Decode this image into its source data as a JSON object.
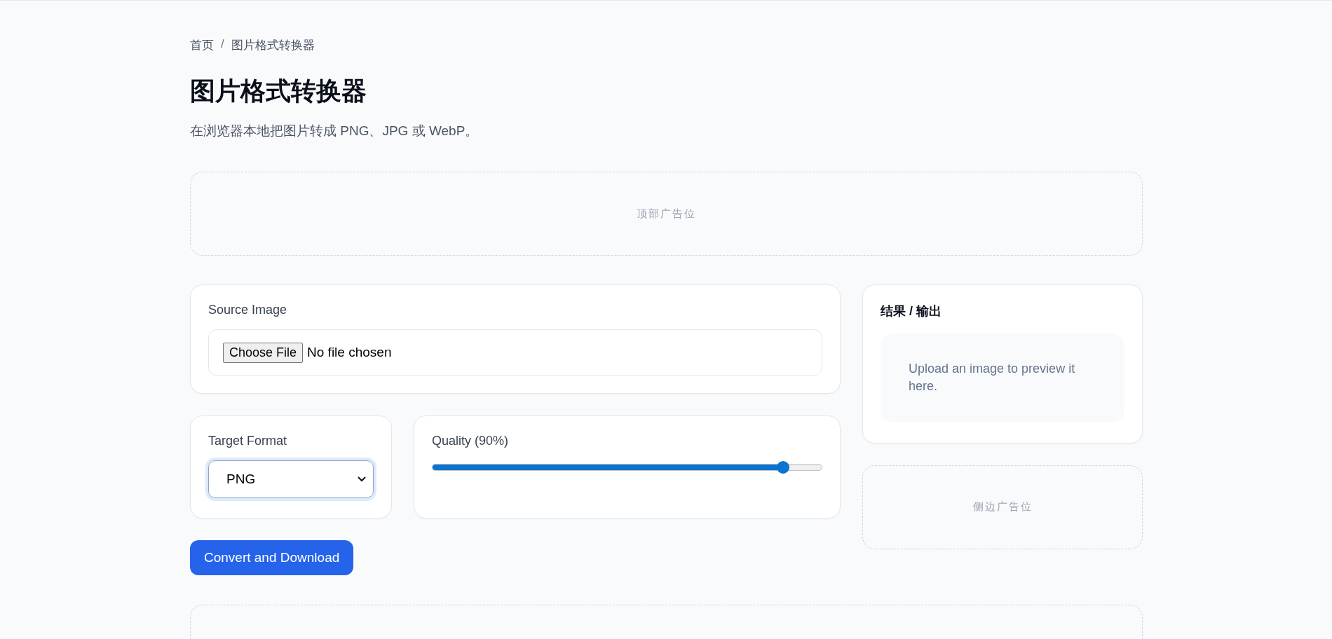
{
  "breadcrumb": [
    {
      "label": "首页"
    },
    {
      "label": "/"
    },
    {
      "label": "图片格式转换器"
    }
  ],
  "title": "图片格式转换器",
  "subtitle": "在浏览器本地把图片转成 PNG、JPG 或 WebP。",
  "top_ad": {
    "label": "顶部广告位"
  },
  "source_image": {
    "label": "Source Image",
    "button": "Choose File",
    "status": "No file chosen"
  },
  "target_format": {
    "label": "Target Format",
    "value": "PNG"
  },
  "quality": {
    "label": "Quality (90%)",
    "level": 0.9
  },
  "convert_button": "Convert and Download",
  "result": {
    "title": "结果 / 输出",
    "placeholder_text": "Upload an image to preview it here."
  },
  "side_ad": {
    "label": "侧边广告位"
  }
}
